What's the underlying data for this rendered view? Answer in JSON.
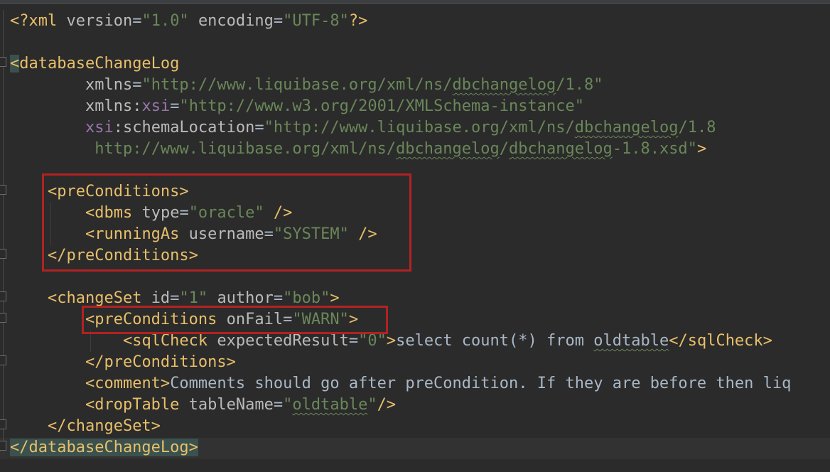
{
  "editor": {
    "lines": [
      {
        "segments": [
          {
            "c": "tag",
            "t": "<?xml "
          },
          {
            "c": "attr",
            "t": "version"
          },
          {
            "c": "txt",
            "t": "="
          },
          {
            "c": "val",
            "t": "\"1.0\""
          },
          {
            "c": "txt",
            "t": " "
          },
          {
            "c": "attr",
            "t": "encoding"
          },
          {
            "c": "txt",
            "t": "="
          },
          {
            "c": "val",
            "t": "\"UTF-8\""
          },
          {
            "c": "tag",
            "t": "?>"
          }
        ]
      },
      {
        "segments": []
      },
      {
        "segments": [
          {
            "c": "tag hl",
            "t": "<"
          },
          {
            "c": "tag",
            "t": "databaseChangeLog"
          }
        ]
      },
      {
        "segments": [
          {
            "c": "txt",
            "t": "        "
          },
          {
            "c": "attr",
            "t": "xmlns"
          },
          {
            "c": "txt",
            "t": "="
          },
          {
            "c": "val",
            "t": "\"http://www.liquibase.org/xml/ns/"
          },
          {
            "c": "val squig",
            "t": "dbchangelog"
          },
          {
            "c": "val",
            "t": "/1.8\""
          }
        ]
      },
      {
        "segments": [
          {
            "c": "txt",
            "t": "        "
          },
          {
            "c": "attr",
            "t": "xmlns:"
          },
          {
            "c": "ns",
            "t": "xsi"
          },
          {
            "c": "txt",
            "t": "="
          },
          {
            "c": "val",
            "t": "\"http://www.w3.org/2001/XMLSchema-instance\""
          }
        ]
      },
      {
        "segments": [
          {
            "c": "txt",
            "t": "        "
          },
          {
            "c": "ns",
            "t": "xsi"
          },
          {
            "c": "attr",
            "t": ":schemaLocation"
          },
          {
            "c": "txt",
            "t": "="
          },
          {
            "c": "val",
            "t": "\"http://www.liquibase.org/xml/ns/"
          },
          {
            "c": "val squig",
            "t": "dbchangelog"
          },
          {
            "c": "val",
            "t": "/1.8"
          }
        ]
      },
      {
        "segments": [
          {
            "c": "txt",
            "t": "         "
          },
          {
            "c": "val",
            "t": "http://www.liquibase.org/xml/ns/"
          },
          {
            "c": "val squig",
            "t": "dbchangelog"
          },
          {
            "c": "val",
            "t": "/"
          },
          {
            "c": "val squig",
            "t": "dbchangelog"
          },
          {
            "c": "val",
            "t": "-1.8.xsd\""
          },
          {
            "c": "tag",
            "t": ">"
          }
        ]
      },
      {
        "segments": []
      },
      {
        "segments": [
          {
            "c": "txt",
            "t": "    "
          },
          {
            "c": "tag",
            "t": "<preConditions>"
          }
        ]
      },
      {
        "segments": [
          {
            "c": "txt",
            "t": "        "
          },
          {
            "c": "tag",
            "t": "<dbms "
          },
          {
            "c": "attr",
            "t": "type"
          },
          {
            "c": "txt",
            "t": "="
          },
          {
            "c": "val",
            "t": "\"oracle\""
          },
          {
            "c": "txt",
            "t": " "
          },
          {
            "c": "tag",
            "t": "/>"
          }
        ]
      },
      {
        "segments": [
          {
            "c": "txt",
            "t": "        "
          },
          {
            "c": "tag",
            "t": "<runningAs "
          },
          {
            "c": "attr",
            "t": "username"
          },
          {
            "c": "txt",
            "t": "="
          },
          {
            "c": "val",
            "t": "\"SYSTEM\""
          },
          {
            "c": "txt",
            "t": " "
          },
          {
            "c": "tag",
            "t": "/>"
          }
        ]
      },
      {
        "segments": [
          {
            "c": "txt",
            "t": "    "
          },
          {
            "c": "tag",
            "t": "</preConditions>"
          }
        ]
      },
      {
        "segments": []
      },
      {
        "segments": [
          {
            "c": "txt",
            "t": "    "
          },
          {
            "c": "tag",
            "t": "<changeSet "
          },
          {
            "c": "attr",
            "t": "id"
          },
          {
            "c": "txt",
            "t": "="
          },
          {
            "c": "val",
            "t": "\"1\""
          },
          {
            "c": "txt",
            "t": " "
          },
          {
            "c": "attr",
            "t": "author"
          },
          {
            "c": "txt",
            "t": "="
          },
          {
            "c": "val",
            "t": "\"bob\""
          },
          {
            "c": "tag",
            "t": ">"
          }
        ]
      },
      {
        "segments": [
          {
            "c": "txt",
            "t": "        "
          },
          {
            "c": "tag",
            "t": "<preConditions "
          },
          {
            "c": "attr",
            "t": "onFail"
          },
          {
            "c": "txt",
            "t": "="
          },
          {
            "c": "val",
            "t": "\"WARN\""
          },
          {
            "c": "tag",
            "t": ">"
          }
        ]
      },
      {
        "segments": [
          {
            "c": "txt",
            "t": "            "
          },
          {
            "c": "tag",
            "t": "<sqlCheck "
          },
          {
            "c": "attr",
            "t": "expectedResult"
          },
          {
            "c": "txt",
            "t": "="
          },
          {
            "c": "val",
            "t": "\"0\""
          },
          {
            "c": "tag",
            "t": ">"
          },
          {
            "c": "txt",
            "t": "select count(*) from "
          },
          {
            "c": "txt squig",
            "t": "oldtable"
          },
          {
            "c": "tag",
            "t": "</sqlCheck>"
          }
        ]
      },
      {
        "segments": [
          {
            "c": "txt",
            "t": "        "
          },
          {
            "c": "tag",
            "t": "</preConditions>"
          }
        ]
      },
      {
        "segments": [
          {
            "c": "txt",
            "t": "        "
          },
          {
            "c": "tag",
            "t": "<comment>"
          },
          {
            "c": "txt",
            "t": "Comments should go after preCondition. If they are before then liq"
          }
        ]
      },
      {
        "segments": [
          {
            "c": "txt",
            "t": "        "
          },
          {
            "c": "tag",
            "t": "<dropTable "
          },
          {
            "c": "attr",
            "t": "tableName"
          },
          {
            "c": "txt",
            "t": "="
          },
          {
            "c": "val",
            "t": "\""
          },
          {
            "c": "val squig",
            "t": "oldtable"
          },
          {
            "c": "val",
            "t": "\""
          },
          {
            "c": "tag",
            "t": "/>"
          }
        ]
      },
      {
        "segments": [
          {
            "c": "txt",
            "t": "    "
          },
          {
            "c": "tag",
            "t": "</changeSet>"
          }
        ]
      },
      {
        "segments": [
          {
            "c": "tag hl",
            "t": "</databaseChangeLog>"
          }
        ]
      }
    ]
  }
}
